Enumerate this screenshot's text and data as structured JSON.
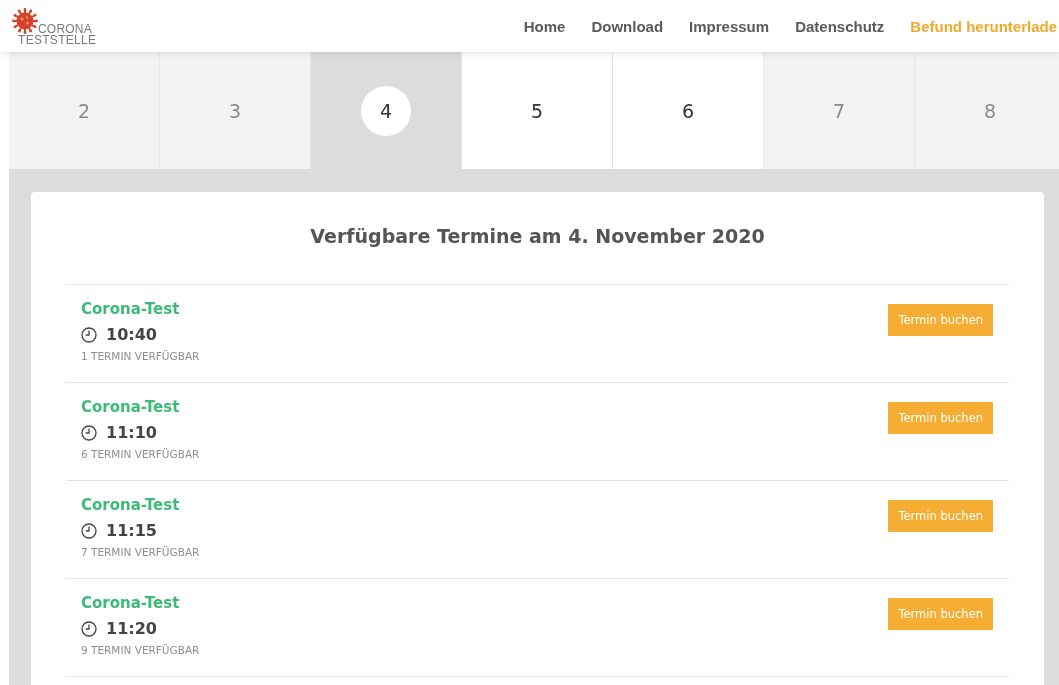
{
  "header": {
    "logo": {
      "line_1": "CORONA",
      "line_2": "TESTSTELLE"
    },
    "nav": [
      {
        "label": "Home",
        "kind": "link"
      },
      {
        "label": "Download",
        "kind": "link"
      },
      {
        "label": "Impressum",
        "kind": "link"
      },
      {
        "label": "Datenschutz",
        "kind": "link"
      },
      {
        "label": "Befund herunterlade",
        "kind": "highlight"
      }
    ]
  },
  "calendar": {
    "days": [
      {
        "label": "2",
        "selected": false,
        "disabled": true
      },
      {
        "label": "3",
        "selected": false,
        "disabled": true
      },
      {
        "label": "4",
        "selected": true,
        "disabled": false
      },
      {
        "label": "5",
        "selected": false,
        "disabled": false
      },
      {
        "label": "6",
        "selected": false,
        "disabled": false
      },
      {
        "label": "7",
        "selected": false,
        "disabled": true
      },
      {
        "label": "8",
        "selected": false,
        "disabled": true
      }
    ]
  },
  "appointments": {
    "title": "Verfügbare Termine am 4. November 2020",
    "slots": [
      {
        "name": "Corona-Test",
        "time": "10:40",
        "availability": "1 TERMIN VERFÜGBAR",
        "button": "Termin buchen"
      },
      {
        "name": "Corona-Test",
        "time": "11:10",
        "availability": "6 TERMIN VERFÜGBAR",
        "button": "Termin buchen"
      },
      {
        "name": "Corona-Test",
        "time": "11:15",
        "availability": "7 TERMIN VERFÜGBAR",
        "button": "Termin buchen"
      },
      {
        "name": "Corona-Test",
        "time": "11:20",
        "availability": "9 TERMIN VERFÜGBAR",
        "button": "Termin buchen"
      }
    ]
  }
}
